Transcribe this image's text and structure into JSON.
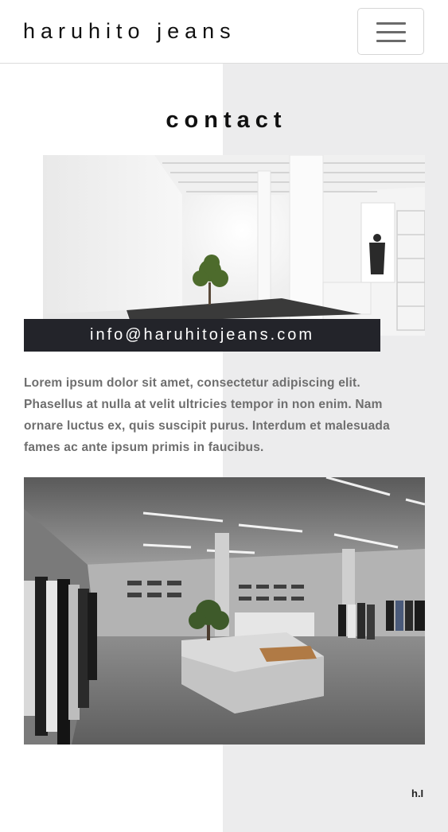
{
  "header": {
    "brand": "haruhito jeans",
    "menu_icon": "hamburger-menu-icon"
  },
  "main": {
    "title": "contact",
    "email": "info@haruhitojeans.com",
    "description": "Lorem ipsum dolor sit amet, consectetur adipiscing elit. Phasellus at nulla at velit ultricies tempor in non enim. Nam ornare luctus ex, quis suscipit purus. Interdum et malesuada fames ac ante ipsum primis in faucibus."
  },
  "footer": {
    "logo_mark": "h.I"
  },
  "colors": {
    "accent_dark": "#23242a",
    "stripe_gray": "#ececed",
    "text_gray": "#6e6e6e"
  }
}
